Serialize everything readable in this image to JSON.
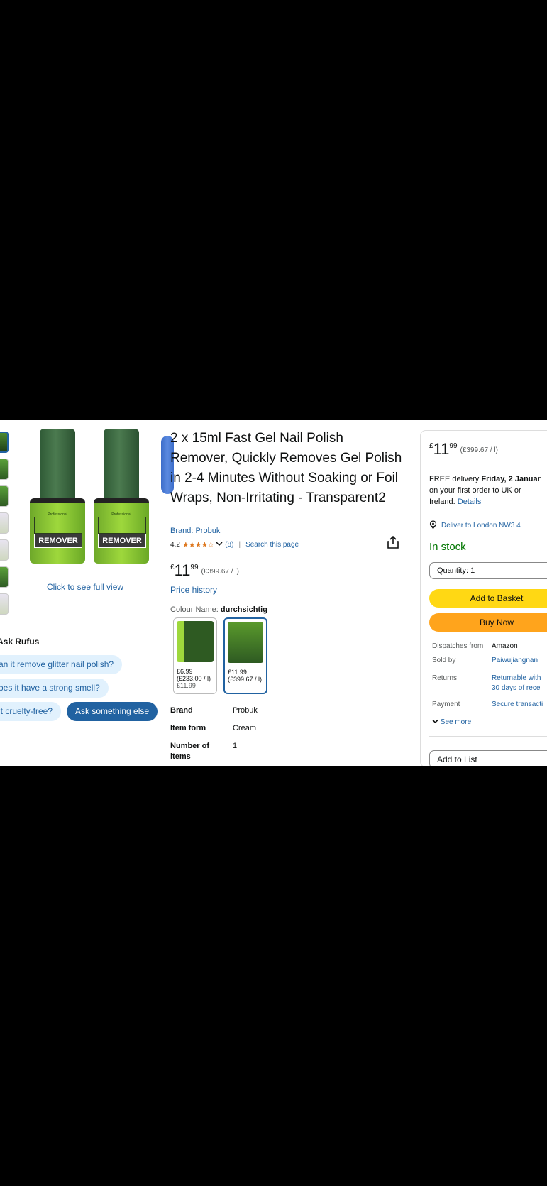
{
  "gallery": {
    "click_full_view": "Click to see full view",
    "bottle_label": "REMOVER"
  },
  "rufus": {
    "title": "Ask Rufus",
    "questions": [
      "an it remove glitter nail polish?",
      "oes it have a strong smell?",
      "it cruelty-free?"
    ],
    "ask_else": "Ask something else"
  },
  "product": {
    "title": "2 x 15ml Fast Gel Nail Polish Remover, Quickly Removes Gel Polish in 2-4 Minutes Without Soaking or Foil Wraps, Non-Irritating - Transparent2",
    "brand_link": "Brand: Probuk",
    "rating": "4.2",
    "stars": "★★★★☆",
    "rating_count": "(8)",
    "search_page": "Search this page",
    "price": {
      "currency": "£",
      "whole": "11",
      "fraction": "99",
      "unit": "(£399.67 / l)"
    },
    "price_history": "Price history",
    "colour_label": "Colour Name: ",
    "colour_value": "durchsichtig",
    "swatches": [
      {
        "price": "£6.99",
        "unit": "(£233.00 / l)",
        "was": "£11.99"
      },
      {
        "price": "£11.99",
        "unit": "(£399.67 / l)",
        "was": ""
      }
    ],
    "specs": [
      {
        "key": "Brand",
        "value": "Probuk"
      },
      {
        "key": "Item form",
        "value": "Cream"
      },
      {
        "key": "Number of items",
        "value": "1"
      }
    ]
  },
  "buybox": {
    "price": {
      "currency": "£",
      "whole": "11",
      "fraction": "99",
      "unit": "(£399.67 / l)"
    },
    "delivery_line1_prefix": "FREE delivery ",
    "delivery_line1_bold": "Friday, 2 Januar",
    "delivery_line2": "on your first order to UK or",
    "delivery_line3_prefix": "Ireland. ",
    "delivery_link": "Details",
    "deliver_to": "Deliver to London NW3 4",
    "stock": "In stock",
    "quantity": "Quantity: 1",
    "add_basket": "Add to Basket",
    "buy_now": "Buy Now",
    "info": [
      {
        "key": "Dispatches from",
        "value": "Amazon"
      },
      {
        "key": "Sold by",
        "value": "Paiwujiangnan"
      },
      {
        "key": "Returns",
        "value": "Returnable with",
        "value2": "30 days of recei"
      },
      {
        "key": "Payment",
        "value": "Secure transacti"
      }
    ],
    "see_more": "See more",
    "add_list": "Add to List"
  },
  "colors": {
    "link": "#2162a1",
    "basket": "#ffd814",
    "buy": "#ffa41c",
    "stock": "#007600",
    "star": "#de7921"
  }
}
